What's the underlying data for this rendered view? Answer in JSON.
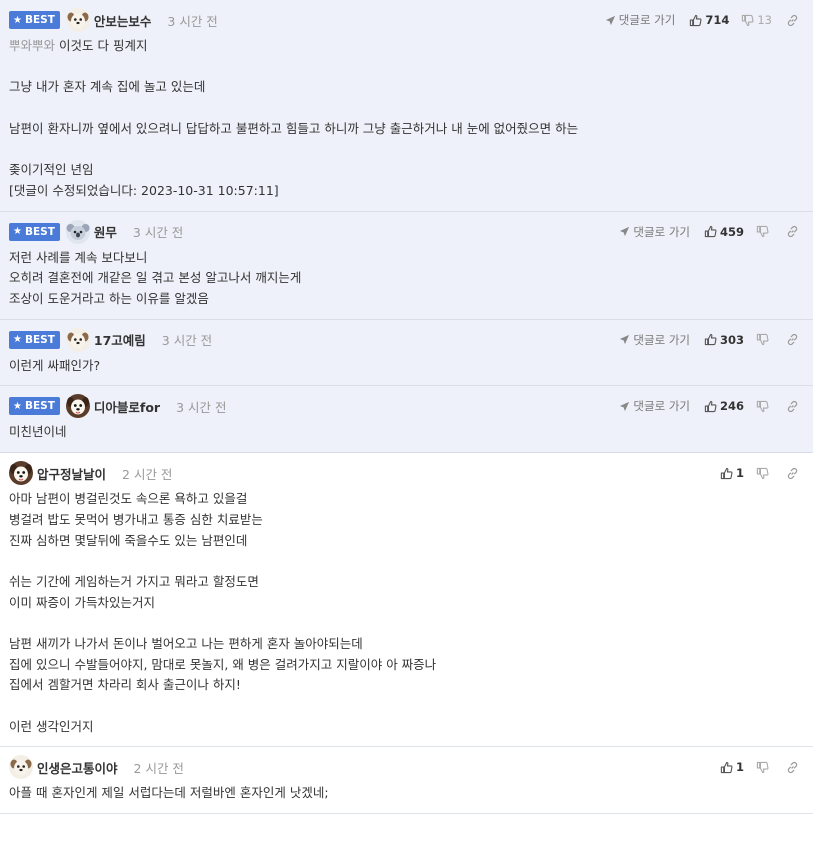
{
  "ui": {
    "best_label": "BEST",
    "reply_label": "댓글로 가기"
  },
  "comments": [
    {
      "best": true,
      "nick": "안보는보수",
      "time": "3 시간 전",
      "up": "714",
      "down": "13",
      "avatar": "dog",
      "lines": [
        {
          "prefix": "뿌와뿌와",
          "text": "이것도 다 핑계지"
        },
        {
          "text": ""
        },
        {
          "text": "그냥 내가 혼자 계속 집에 놀고 있는데"
        },
        {
          "text": ""
        },
        {
          "text": "남편이 환자니까 옆에서 있으려니 답답하고 불편하고 힘들고 하니까 그냥 출근하거나 내 눈에 없어줬으면 하는"
        },
        {
          "text": ""
        },
        {
          "text": "좆이기적인 년임"
        },
        {
          "text": "[댓글이 수정되었습니다: 2023-10-31 10:57:11]"
        }
      ]
    },
    {
      "best": true,
      "nick": "원무",
      "time": "3 시간 전",
      "up": "459",
      "down": "",
      "avatar": "koala",
      "lines": [
        {
          "text": "저런 사례를 계속 보다보니"
        },
        {
          "text": "오히려 결혼전에 개같은 일 겪고 본성 알고나서 깨지는게"
        },
        {
          "text": "조상이 도운거라고 하는 이유를 알겠음"
        }
      ]
    },
    {
      "best": true,
      "nick": "17고예림",
      "time": "3 시간 전",
      "up": "303",
      "down": "",
      "avatar": "dog",
      "lines": [
        {
          "text": "이런게 싸패인가?"
        }
      ]
    },
    {
      "best": true,
      "nick": "디아블로for",
      "time": "3 시간 전",
      "up": "246",
      "down": "",
      "avatar": "dog2",
      "lines": [
        {
          "text": "미친년이네"
        }
      ]
    },
    {
      "best": false,
      "nick": "압구정날날이",
      "time": "2 시간 전",
      "up": "1",
      "down": "",
      "avatar": "dog2",
      "lines": [
        {
          "text": "아마 남편이 병걸린것도 속으론 욕하고 있을걸"
        },
        {
          "text": "병걸려 밥도 못먹어 병가내고 통증 심한 치료받는"
        },
        {
          "text": "진짜 심하면 몇달뒤에 죽을수도 있는 남편인데"
        },
        {
          "text": ""
        },
        {
          "text": "쉬는 기간에 게임하는거 가지고 뭐라고 할정도면"
        },
        {
          "text": "이미 짜증이 가득차있는거지"
        },
        {
          "text": ""
        },
        {
          "text": "남편 새끼가 나가서 돈이나 벌어오고 나는 편하게 혼자 놀아야되는데"
        },
        {
          "text": "집에 있으니 수발들어야지, 맘대로 못놀지, 왜 병은 걸려가지고 지랄이야 아 짜증나"
        },
        {
          "text": "집에서 겜할거면 차라리 회사 출근이나 하지!"
        },
        {
          "text": ""
        },
        {
          "text": "이런 생각인거지"
        }
      ]
    },
    {
      "best": false,
      "nick": "인생은고통이야",
      "time": "2 시간 전",
      "up": "1",
      "down": "",
      "avatar": "dog",
      "lines": [
        {
          "text": "아플 때 혼자인게 제일 서럽다는데 저럴바엔 혼자인게 낫겠네;"
        }
      ]
    }
  ]
}
